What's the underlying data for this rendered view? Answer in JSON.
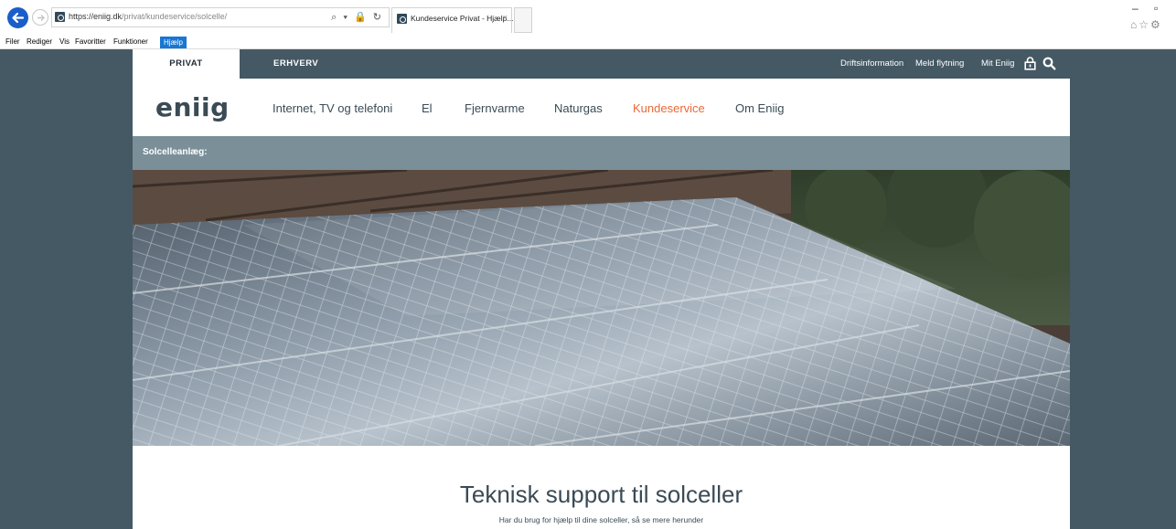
{
  "browser": {
    "url_host": "https://eniig.dk",
    "url_path": "/privat/kundeservice/solcelle/",
    "address_controls": "⌕ ▾ 🔒 ↻",
    "tab_title": "Kundeservice Privat - Hjælp...",
    "tab_close": "×",
    "minimize": "–",
    "restore": "▫",
    "toolbar_icons": "⌂☆⚙"
  },
  "menubar": {
    "items": [
      "Filer",
      "Rediger",
      "Vis",
      "Favoritter",
      "Funktioner",
      "Hjælp"
    ]
  },
  "site": {
    "topbar": {
      "tab_private": "PRIVAT",
      "tab_business": "ERHVERV",
      "links": [
        "Driftsinformation",
        "Meld flytning",
        "Mit Eniig"
      ]
    },
    "logo": "eniig",
    "nav": [
      "Internet, TV og telefoni",
      "El",
      "Fjernvarme",
      "Naturgas",
      "Kundeservice",
      "Om Eniig"
    ],
    "nav_active": "Kundeservice",
    "breadcrumb": "Solcelleanlæg:",
    "heading": "Teknisk support til solceller",
    "subheading": "Har du brug for hjælp til dine solceller, så se mere herunder"
  },
  "colors": {
    "brand_dark": "#455964",
    "accent": "#e86a3b",
    "breadcrumb_bar": "#7b8f99"
  }
}
